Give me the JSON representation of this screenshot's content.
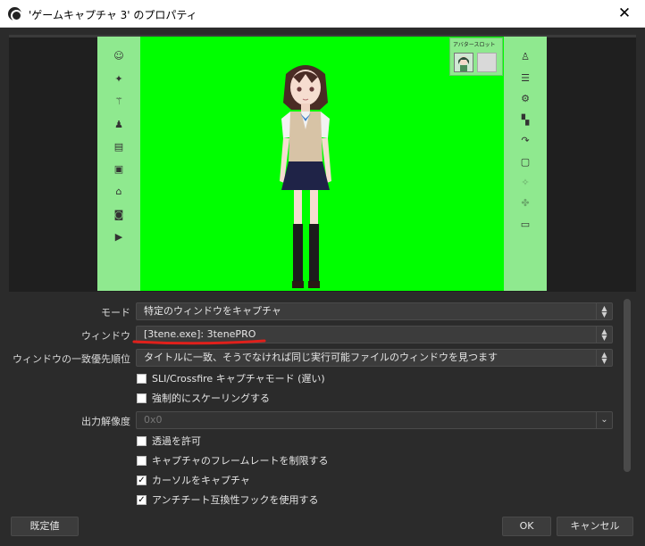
{
  "window": {
    "title": "'ゲームキャプチャ 3' のプロパティ",
    "close_glyph": "✕"
  },
  "preview": {
    "avatar_slot_label": "アバタースロット"
  },
  "form": {
    "mode": {
      "label": "モード",
      "value": "特定のウィンドウをキャプチャ"
    },
    "window": {
      "label": "ウィンドウ",
      "value": "[3tene.exe]: 3tenePRO"
    },
    "match_priority": {
      "label": "ウィンドウの一致優先順位",
      "value": "タイトルに一致、そうでなければ同じ実行可能ファイルのウィンドウを見つます"
    },
    "sli_crossfire": {
      "label": "SLI/Crossfire キャプチャモード (遅い)",
      "checked": false
    },
    "force_scaling": {
      "label": "強制的にスケーリングする",
      "checked": false
    },
    "output_resolution": {
      "label": "出力解像度",
      "value": "0x0"
    },
    "allow_transparency": {
      "label": "透過を許可",
      "checked": false
    },
    "limit_framerate": {
      "label": "キャプチャのフレームレートを制限する",
      "checked": false
    },
    "capture_cursor": {
      "label": "カーソルをキャプチャ",
      "checked": true
    },
    "anti_cheat_hook": {
      "label": "アンチチート互換性フックを使用する",
      "checked": true
    }
  },
  "buttons": {
    "defaults": "既定値",
    "ok": "OK",
    "cancel": "キャンセル"
  },
  "colors": {
    "chroma_green": "#00ff00",
    "panel_green": "#8fe98f",
    "annotation_red": "#e0201b"
  }
}
